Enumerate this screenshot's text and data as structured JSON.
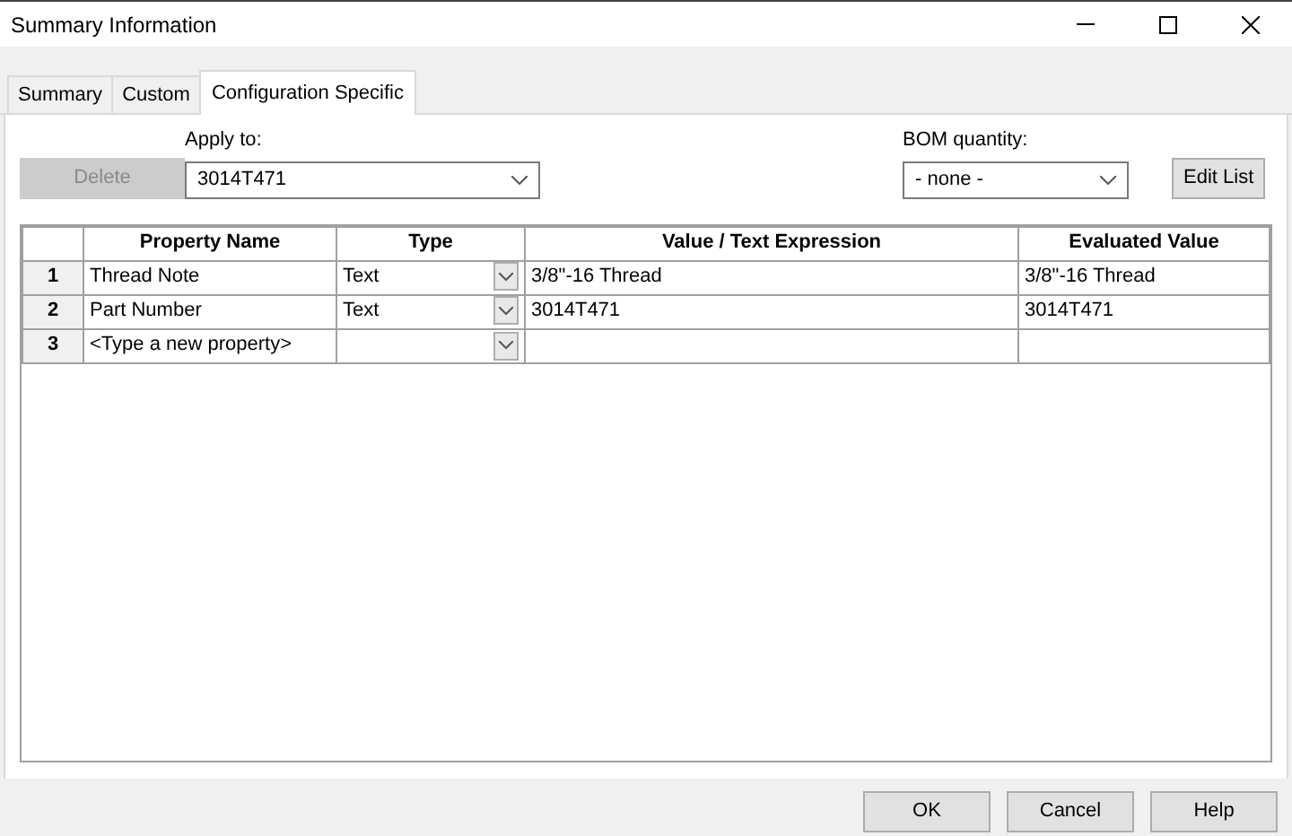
{
  "window": {
    "title": "Summary Information"
  },
  "tabs": [
    {
      "label": "Summary",
      "selected": false
    },
    {
      "label": "Custom",
      "selected": false
    },
    {
      "label": "Configuration Specific",
      "selected": true
    }
  ],
  "delete_button": {
    "label": "Delete",
    "disabled": true
  },
  "apply_to": {
    "label": "Apply to:",
    "value": "3014T471"
  },
  "bom_quantity": {
    "label": "BOM quantity:",
    "value": "- none -"
  },
  "edit_list_button": {
    "label": "Edit List"
  },
  "table": {
    "columns": [
      "Property Name",
      "Type",
      "Value / Text Expression",
      "Evaluated Value"
    ],
    "rows": [
      {
        "number": "1",
        "name": "Thread Note",
        "type": "Text",
        "value": "3/8\"-16 Thread",
        "evaluated": "3/8\"-16 Thread"
      },
      {
        "number": "2",
        "name": "Part Number",
        "type": "Text",
        "value": "3014T471",
        "evaluated": "3014T471"
      },
      {
        "number": "3",
        "placeholder": "<Type a new property>"
      }
    ]
  },
  "buttons": [
    "OK",
    "Cancel",
    "Help"
  ]
}
